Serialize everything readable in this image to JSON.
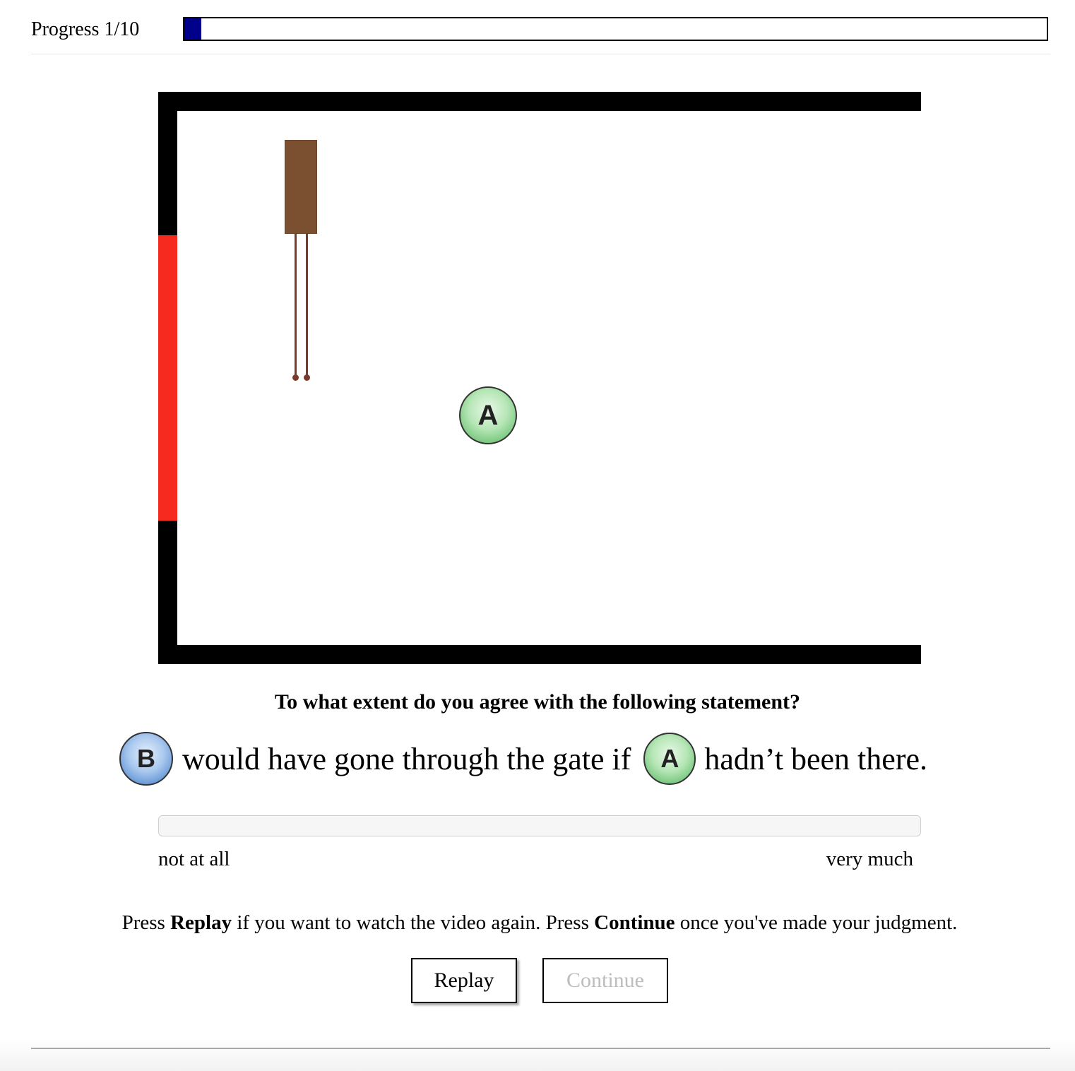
{
  "progress": {
    "label": "Progress 1/10",
    "current": 1,
    "total": 10,
    "fill_fraction": 0.02,
    "fill_color": "#00008b"
  },
  "stage": {
    "wall_color": "#000000",
    "gate_color": "#f72a1f",
    "box_color": "#7b5030",
    "ball_a_label": "A"
  },
  "question": {
    "prompt": "To what extent do you agree with the following statement?",
    "statement": {
      "ball_b_label": "B",
      "text_middle": "would have gone through the gate if",
      "ball_a_label": "A",
      "text_end": "hadn’t been there."
    }
  },
  "slider": {
    "min_label": "not at all",
    "max_label": "very much"
  },
  "instructions": {
    "part1": "Press ",
    "replay_word": "Replay",
    "part2": " if you want to watch the video again. Press ",
    "continue_word": "Continue",
    "part3": " once you've made your judgment."
  },
  "buttons": {
    "replay": "Replay",
    "continue": "Continue"
  }
}
